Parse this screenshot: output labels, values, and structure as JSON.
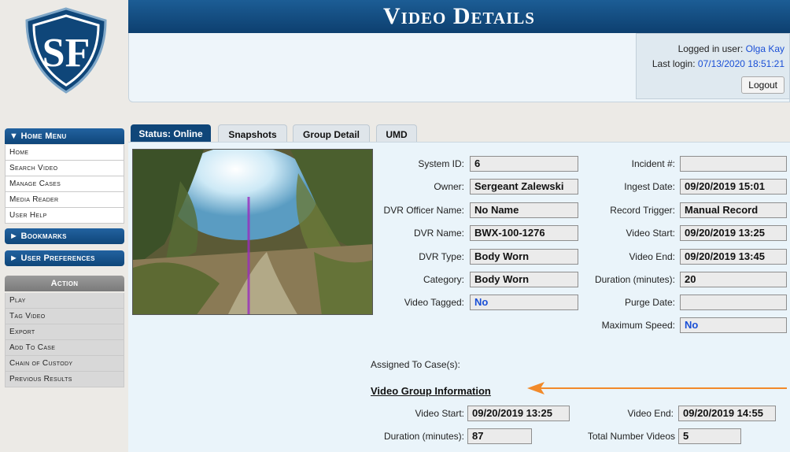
{
  "header": {
    "title": "Video Details",
    "logo_text": "SF",
    "login": {
      "user_label": "Logged in user:",
      "user_name": "Olga Kay",
      "last_login_label": "Last login:",
      "last_login_value": "07/13/2020 18:51:21",
      "logout_label": "Logout"
    }
  },
  "sidebar": {
    "home_menu": {
      "title": "▼ Home Menu",
      "items": [
        "Home",
        "Search Video",
        "Manage Cases",
        "Media Reader",
        "User Help"
      ]
    },
    "bookmarks": "► Bookmarks",
    "user_preferences": "► User Preferences",
    "action": {
      "title": "Action",
      "items": [
        "Play",
        "Tag Video",
        "Export",
        "Add To Case",
        "Chain of Custody",
        "Previous Results"
      ]
    }
  },
  "tabs": [
    "Status: Online",
    "Snapshots",
    "Group Detail",
    "UMD"
  ],
  "details": {
    "left": [
      {
        "label": "System ID:",
        "value": "6"
      },
      {
        "label": "Owner:",
        "value": "Sergeant Zalewski"
      },
      {
        "label": "DVR Officer Name:",
        "value": "No Name"
      },
      {
        "label": "DVR Name:",
        "value": "BWX-100-1276"
      },
      {
        "label": "DVR Type:",
        "value": "Body Worn"
      },
      {
        "label": "Category:",
        "value": "Body Worn"
      },
      {
        "label": "Video Tagged:",
        "value": "No"
      }
    ],
    "right": [
      {
        "label": "Incident #:",
        "value": ""
      },
      {
        "label": "Ingest Date:",
        "value": "09/20/2019 15:01"
      },
      {
        "label": "Record Trigger:",
        "value": "Manual Record"
      },
      {
        "label": "Video Start:",
        "value": "09/20/2019 13:25"
      },
      {
        "label": "Video End:",
        "value": "09/20/2019 13:45"
      },
      {
        "label": "Duration (minutes):",
        "value": "20"
      },
      {
        "label": "Purge Date:",
        "value": ""
      },
      {
        "label": "Maximum Speed:",
        "value": "No"
      }
    ],
    "assigned_label": "Assigned To Case(s):"
  },
  "video_group": {
    "title": "Video Group Information",
    "start_label": "Video Start:",
    "start_value": "09/20/2019 13:25",
    "end_label": "Video End:",
    "end_value": "09/20/2019 14:55",
    "duration_label": "Duration (minutes):",
    "duration_value": "87",
    "total_label": "Total Number Videos",
    "total_value": "5"
  },
  "colors": {
    "header_blue": "#0f4679",
    "accent_orange": "#f28a2a",
    "link_blue": "#1a4fd6"
  }
}
